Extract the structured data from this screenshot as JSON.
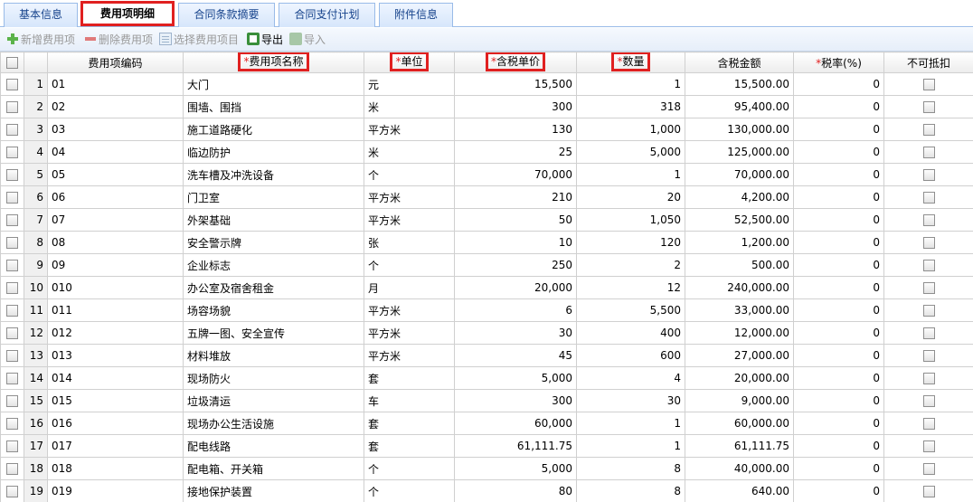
{
  "tabs": [
    "基本信息",
    "费用项明细",
    "合同条款摘要",
    "合同支付计划",
    "附件信息"
  ],
  "active_tab": 1,
  "toolbar": {
    "add": "新增费用项",
    "delete": "删除费用项",
    "select": "选择费用项目",
    "export": "导出",
    "import": "导入"
  },
  "columns": {
    "code": "费用项编码",
    "name": "费用项名称",
    "unit": "单位",
    "price": "含税单价",
    "qty": "数量",
    "amount": "含税金额",
    "rate": "税率(%)",
    "nondeduct": "不可抵扣",
    "required_mark": "*"
  },
  "rows": [
    {
      "n": "1",
      "code": "01",
      "name": "大门",
      "unit": "元",
      "price": "15,500",
      "qty": "1",
      "amount": "15,500.00",
      "rate": "0"
    },
    {
      "n": "2",
      "code": "02",
      "name": "围墙、围挡",
      "unit": "米",
      "price": "300",
      "qty": "318",
      "amount": "95,400.00",
      "rate": "0"
    },
    {
      "n": "3",
      "code": "03",
      "name": "施工道路硬化",
      "unit": "平方米",
      "price": "130",
      "qty": "1,000",
      "amount": "130,000.00",
      "rate": "0"
    },
    {
      "n": "4",
      "code": "04",
      "name": "临边防护",
      "unit": "米",
      "price": "25",
      "qty": "5,000",
      "amount": "125,000.00",
      "rate": "0"
    },
    {
      "n": "5",
      "code": "05",
      "name": "洗车槽及冲洗设备",
      "unit": "个",
      "price": "70,000",
      "qty": "1",
      "amount": "70,000.00",
      "rate": "0"
    },
    {
      "n": "6",
      "code": "06",
      "name": "门卫室",
      "unit": "平方米",
      "price": "210",
      "qty": "20",
      "amount": "4,200.00",
      "rate": "0"
    },
    {
      "n": "7",
      "code": "07",
      "name": "外架基础",
      "unit": "平方米",
      "price": "50",
      "qty": "1,050",
      "amount": "52,500.00",
      "rate": "0"
    },
    {
      "n": "8",
      "code": "08",
      "name": "安全警示牌",
      "unit": "张",
      "price": "10",
      "qty": "120",
      "amount": "1,200.00",
      "rate": "0"
    },
    {
      "n": "9",
      "code": "09",
      "name": "企业标志",
      "unit": "个",
      "price": "250",
      "qty": "2",
      "amount": "500.00",
      "rate": "0"
    },
    {
      "n": "10",
      "code": "010",
      "name": "办公室及宿舍租金",
      "unit": "月",
      "price": "20,000",
      "qty": "12",
      "amount": "240,000.00",
      "rate": "0"
    },
    {
      "n": "11",
      "code": "011",
      "name": "场容场貌",
      "unit": "平方米",
      "price": "6",
      "qty": "5,500",
      "amount": "33,000.00",
      "rate": "0"
    },
    {
      "n": "12",
      "code": "012",
      "name": "五牌一图、安全宣传",
      "unit": "平方米",
      "price": "30",
      "qty": "400",
      "amount": "12,000.00",
      "rate": "0"
    },
    {
      "n": "13",
      "code": "013",
      "name": "材料堆放",
      "unit": "平方米",
      "price": "45",
      "qty": "600",
      "amount": "27,000.00",
      "rate": "0"
    },
    {
      "n": "14",
      "code": "014",
      "name": "现场防火",
      "unit": "套",
      "price": "5,000",
      "qty": "4",
      "amount": "20,000.00",
      "rate": "0"
    },
    {
      "n": "15",
      "code": "015",
      "name": "垃圾清运",
      "unit": "车",
      "price": "300",
      "qty": "30",
      "amount": "9,000.00",
      "rate": "0"
    },
    {
      "n": "16",
      "code": "016",
      "name": "现场办公生活设施",
      "unit": "套",
      "price": "60,000",
      "qty": "1",
      "amount": "60,000.00",
      "rate": "0"
    },
    {
      "n": "17",
      "code": "017",
      "name": "配电线路",
      "unit": "套",
      "price": "61,111.75",
      "qty": "1",
      "amount": "61,111.75",
      "rate": "0"
    },
    {
      "n": "18",
      "code": "018",
      "name": "配电箱、开关箱",
      "unit": "个",
      "price": "5,000",
      "qty": "8",
      "amount": "40,000.00",
      "rate": "0"
    },
    {
      "n": "19",
      "code": "019",
      "name": "接地保护装置",
      "unit": "个",
      "price": "80",
      "qty": "8",
      "amount": "640.00",
      "rate": "0"
    }
  ]
}
